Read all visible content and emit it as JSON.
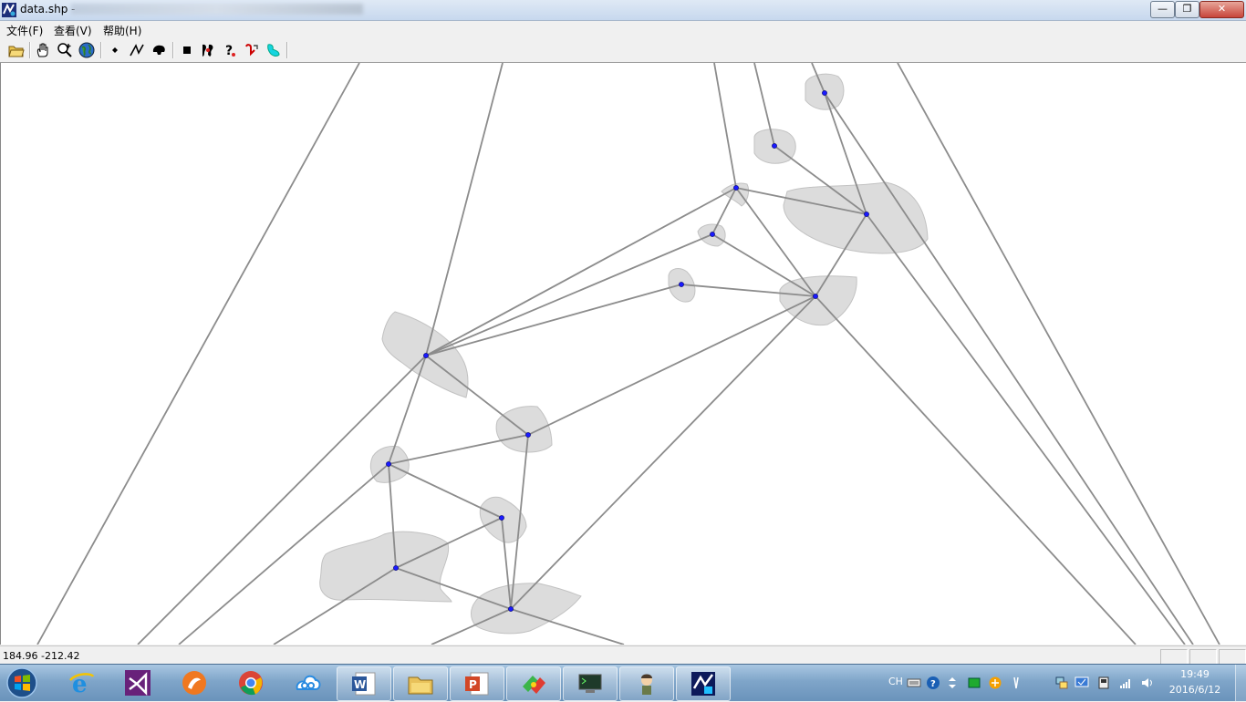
{
  "window": {
    "title": "data.shp -",
    "minimize_glyph": "—",
    "maximize_glyph": "❐",
    "close_glyph": "✕"
  },
  "menu": {
    "items": [
      {
        "label": "文件(F)"
      },
      {
        "label": "查看(V)"
      },
      {
        "label": "帮助(H)"
      }
    ]
  },
  "toolbar": {
    "tools": [
      {
        "icon": "open-folder-icon"
      },
      {
        "icon": "pan-hand-icon"
      },
      {
        "icon": "zoom-in-icon"
      },
      {
        "icon": "globe-full-extent-icon"
      },
      {
        "icon": "point-layer-icon"
      },
      {
        "icon": "polyline-layer-icon"
      },
      {
        "icon": "polygon-layer-icon"
      },
      {
        "icon": "square-stop-icon"
      },
      {
        "icon": "select-feature-icon"
      },
      {
        "icon": "help-question-icon"
      },
      {
        "icon": "identify-icon"
      },
      {
        "icon": "fill-color-icon"
      }
    ]
  },
  "status": {
    "coordinates": "184.96  -212.42"
  },
  "taskbar": {
    "ime": "CH",
    "time": "19:49",
    "date": "2016/6/12",
    "apps": [
      "internet-explorer-icon",
      "visual-studio-icon",
      "app-orange-icon",
      "chrome-icon",
      "baidu-cloud-icon",
      "word-icon",
      "file-explorer-icon",
      "powerpoint-icon",
      "app-colorful-icon",
      "terminal-monitor-icon",
      "character-icon",
      "gis-app-icon"
    ]
  },
  "colors": {
    "polygon_fill": "#dcdcdc",
    "polygon_stroke": "#bdbdbd",
    "line_stroke": "#8c8c8c",
    "point_fill": "#1a1aff"
  }
}
